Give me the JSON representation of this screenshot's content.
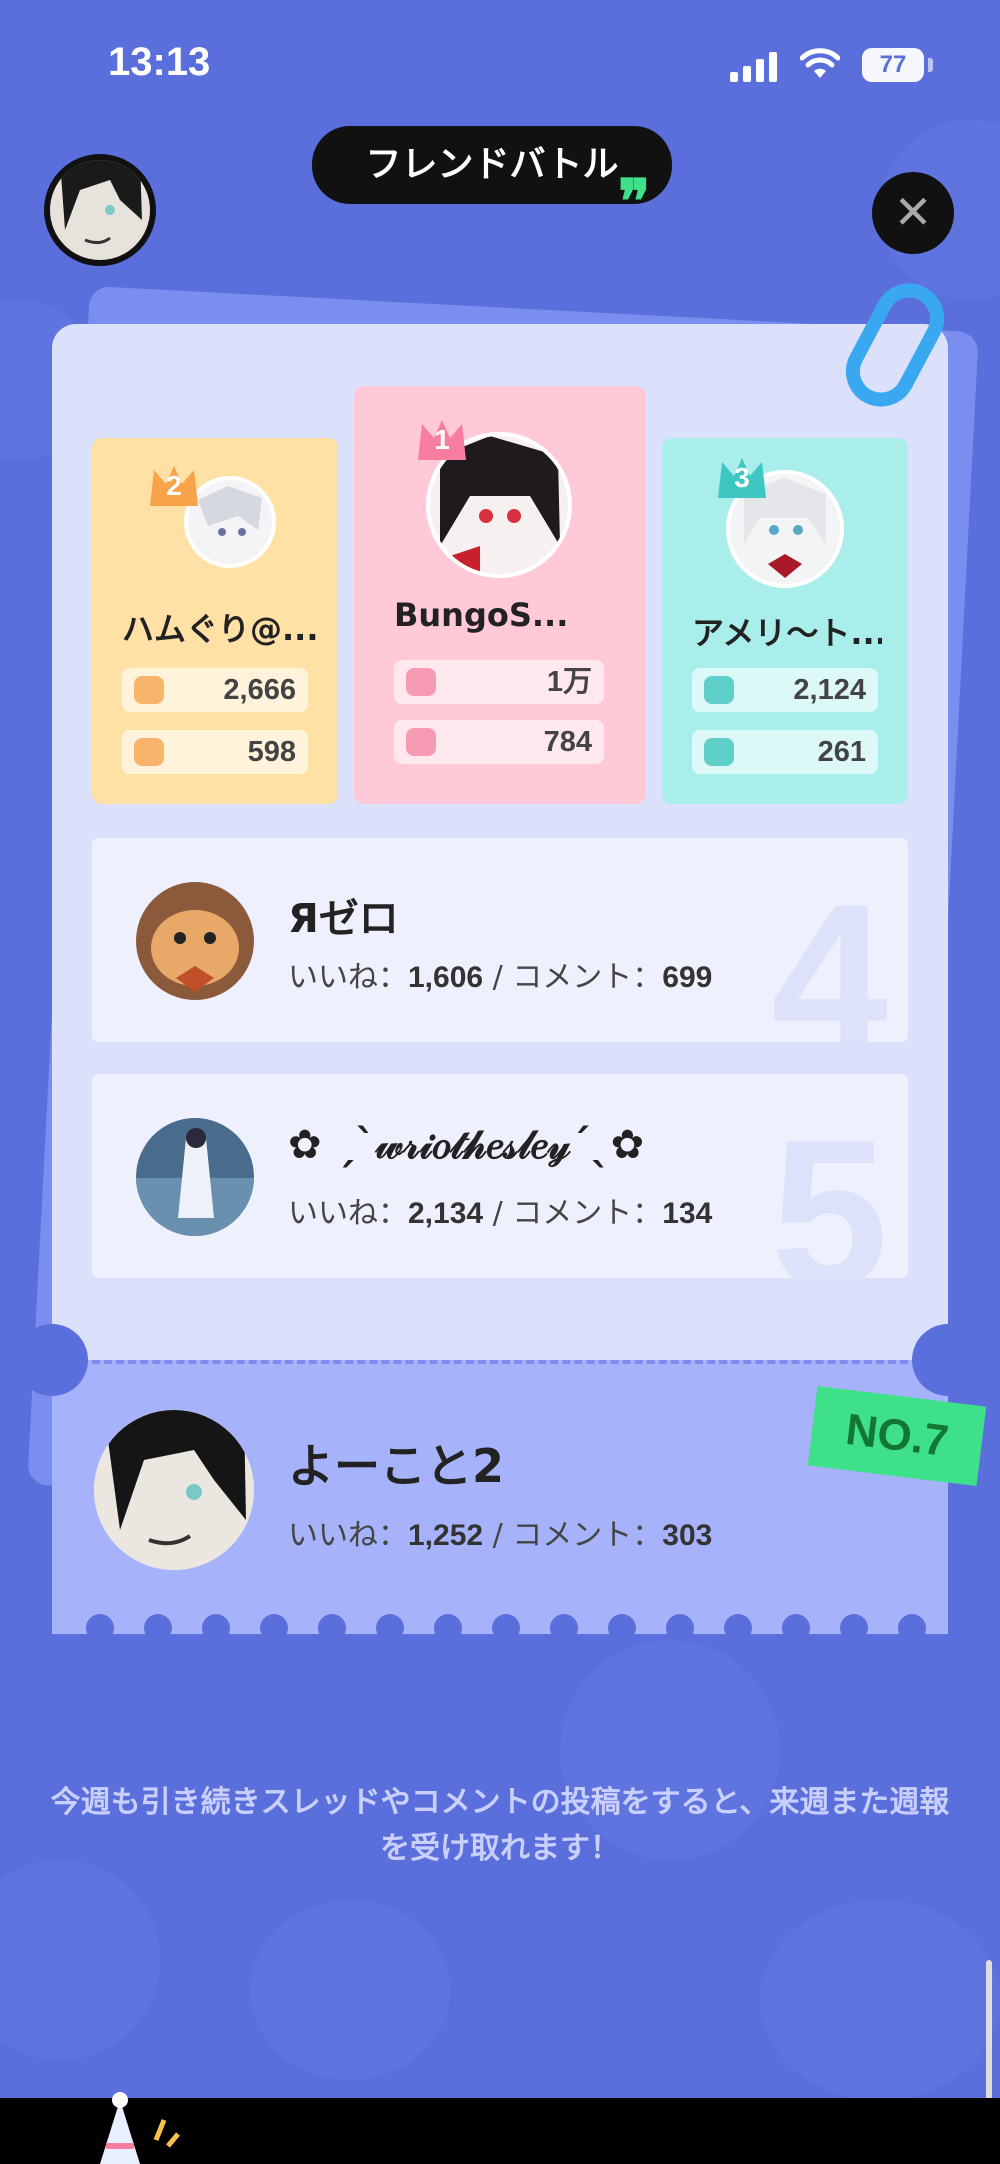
{
  "status_bar": {
    "time": "13:13",
    "battery": "77"
  },
  "header": {
    "title": "フレンドバトル",
    "close_label": "✕"
  },
  "podium": [
    {
      "rank": "2",
      "name": "ハムぐり@...",
      "likes": "2,666",
      "comments": "598",
      "color": "#ffe1a6",
      "accent": "#f8a24a"
    },
    {
      "rank": "1",
      "name": "BungoS...",
      "likes": "1万",
      "comments": "784",
      "color": "#ffc9d8",
      "accent": "#f77ea0"
    },
    {
      "rank": "3",
      "name": "アメリ～ト...",
      "likes": "2,124",
      "comments": "261",
      "color": "#a9eeea",
      "accent": "#3ec7c2"
    }
  ],
  "ranks": [
    {
      "rank": "4",
      "name": "Яゼロ",
      "likes_label": "いいね：",
      "likes": "1,606",
      "sep": " / ",
      "comments_label": "コメント：",
      "comments": "699"
    },
    {
      "rank": "5",
      "name": "✿ ˏˋ𝓌𝓇𝒾𝑜𝓉𝒽𝑒𝓈𝓁𝑒𝓎ˊˎ✿",
      "likes_label": "いいね：",
      "likes": "2,134",
      "sep": " / ",
      "comments_label": "コメント：",
      "comments": "134"
    }
  ],
  "me": {
    "tag": "NO.7",
    "name": "よーこと2",
    "likes_label": "いいね：",
    "likes": "1,252",
    "sep": " / ",
    "comments_label": "コメント：",
    "comments": "303"
  },
  "footer_note": "今週も引き続きスレッドやコメントの投稿をすると、来週また週報を受け取れます！",
  "colors": {
    "background": "#5a6fdc",
    "card": "#dbe0fb",
    "highlight": "#a6b3fa",
    "tag": "#3ee08a"
  }
}
